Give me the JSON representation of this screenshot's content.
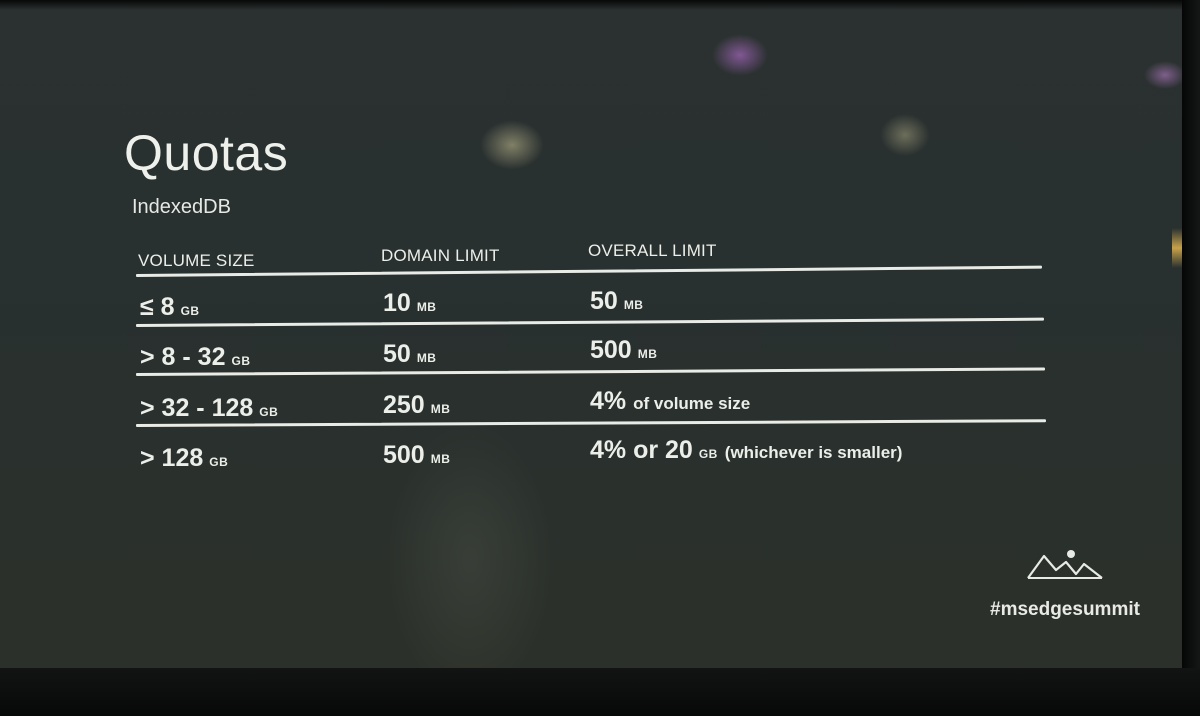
{
  "slide": {
    "title": "Quotas",
    "subtitle": "IndexedDB",
    "hashtag": "#msedgesummit"
  },
  "table": {
    "headers": [
      "VOLUME SIZE",
      "DOMAIN LIMIT",
      "OVERALL LIMIT"
    ],
    "rows": [
      {
        "volume": {
          "value": "≤ 8",
          "unit": "GB"
        },
        "domain": {
          "value": "10",
          "unit": "MB"
        },
        "overall": {
          "value": "50",
          "unit": "MB",
          "note": ""
        }
      },
      {
        "volume": {
          "value": "> 8 - 32",
          "unit": "GB"
        },
        "domain": {
          "value": "50",
          "unit": "MB"
        },
        "overall": {
          "value": "500",
          "unit": "MB",
          "note": ""
        }
      },
      {
        "volume": {
          "value": "> 32 - 128",
          "unit": "GB"
        },
        "domain": {
          "value": "250",
          "unit": "MB"
        },
        "overall": {
          "value": "4%",
          "unit": "",
          "note": "of volume size"
        }
      },
      {
        "volume": {
          "value": "> 128",
          "unit": "GB"
        },
        "domain": {
          "value": "500",
          "unit": "MB"
        },
        "overall": {
          "value": "4% or 20",
          "unit": "GB",
          "note": "(whichever is smaller)"
        }
      }
    ]
  },
  "icons": {
    "logo": "mountain-logo-icon"
  },
  "colors": {
    "background": "#2a302e",
    "text": "#eceee9"
  }
}
